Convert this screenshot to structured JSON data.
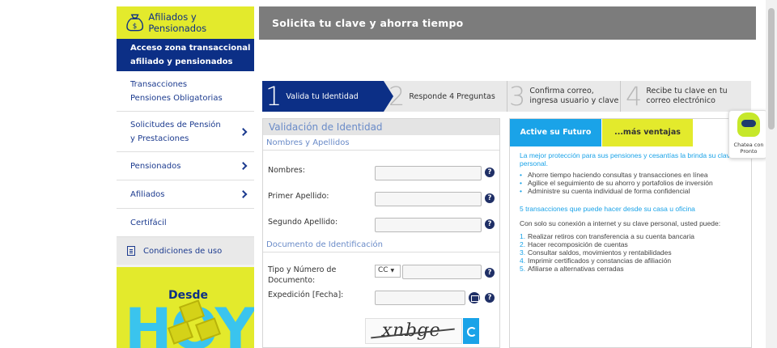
{
  "sidebar": {
    "header": "Afiliados y Pensionados",
    "active": "Acceso zona transaccional afiliado y pensionados",
    "items": [
      {
        "label": "Transacciones Pensiones Obligatorias",
        "chevron": false
      },
      {
        "label": "Solicitudes de Pensión y Prestaciones",
        "chevron": true
      },
      {
        "label": "Pensionados",
        "chevron": true
      },
      {
        "label": "Afiliados",
        "chevron": true
      },
      {
        "label": "Certifácil",
        "chevron": false
      }
    ],
    "conditions": "Condiciones de uso",
    "promo": {
      "desde": "Desde",
      "hoy": "HOY"
    }
  },
  "header": {
    "title": "Solicita tu clave y ahorra tiempo"
  },
  "steps": [
    {
      "num": "1",
      "label": "Valida tu Identidad"
    },
    {
      "num": "2",
      "label": "Responde 4 Preguntas"
    },
    {
      "num": "3",
      "label": "Confirma correo, ingresa usuario y clave"
    },
    {
      "num": "4",
      "label": "Recibe tu clave en tu correo electrónico"
    }
  ],
  "form": {
    "title": "Validación de Identidad",
    "section1": "Nombres y Apellidos",
    "section2": "Documento de Identificación",
    "fields": {
      "nombres": "Nombres:",
      "primer": "Primer Apellido:",
      "segundo": "Segundo Apellido:",
      "tipo": "Tipo y Número de Documento:",
      "expedicion": "Expedición [Fecha]:"
    },
    "doc_type": "CC",
    "captcha_text": "xnbge",
    "help_glyph": "?"
  },
  "info": {
    "tab_active": "Active su Futuro",
    "tab_more": "...más ventajas",
    "intro": "La mejor protección para sus pensiones y cesantías la brinda su clave personal.",
    "bullets": [
      "Ahorre tiempo haciendo consultas y transacciones en línea",
      "Agilice el seguimiento de su ahorro y portafolios de inversión",
      "Administre su cuenta individual de forma confidencial"
    ],
    "subtitle": "5 transacciones que puede hacer desde su casa u oficina",
    "lead": "Con solo su conexión a internet y su clave personal, usted puede:",
    "numbered": [
      "Realizar retiros con transferencia a su cuenta bancaria",
      "Hacer recomposición de cuentas",
      "Consultar saldos, movimientos y rentabilidades",
      "Imprimir certificados y constancias de afiliación",
      "Afiliarse a alternativas cerradas"
    ]
  },
  "chat": {
    "label": "Chatea con Pronto"
  },
  "colors": {
    "brand_blue": "#0c2f86",
    "brand_yellow": "#e3ea2c",
    "accent_cyan": "#1aa3e8"
  }
}
